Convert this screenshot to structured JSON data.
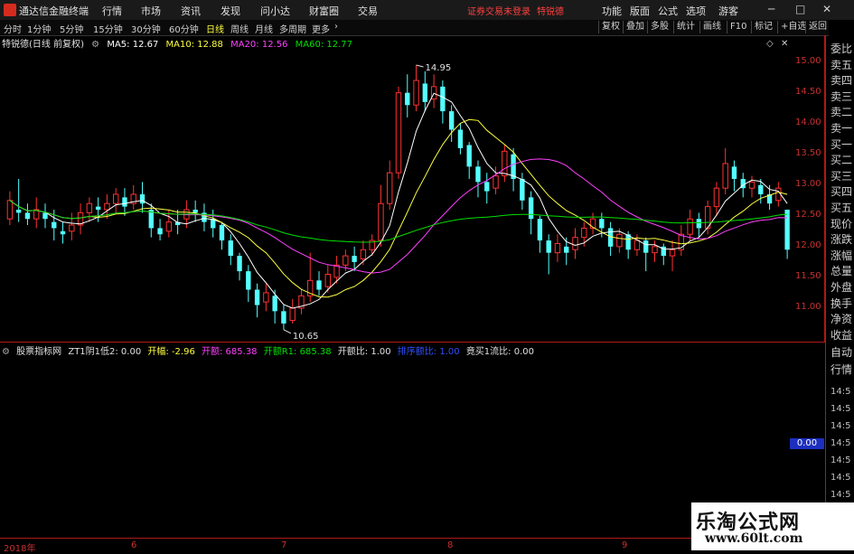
{
  "app": {
    "title": "通达信金融终端"
  },
  "menu": {
    "items": [
      "行情",
      "市场",
      "资讯",
      "发现",
      "问小达",
      "财富圈",
      "交易"
    ]
  },
  "header": {
    "login_notice": "证券交易未登录",
    "user": "特锐德"
  },
  "right_menu": [
    "功能",
    "版面",
    "公式",
    "选项",
    "游客"
  ],
  "periods": {
    "items": [
      "分时",
      "1分钟",
      "5分钟",
      "15分钟",
      "30分钟",
      "60分钟",
      "日线",
      "周线",
      "月线",
      "多周期",
      "更多"
    ],
    "active": "日线"
  },
  "toolbar": [
    "复权",
    "叠加",
    "多股",
    "统计",
    "画线",
    "F10",
    "标记",
    "+自选",
    "返回"
  ],
  "chart_header": {
    "stock": "特锐德(日线 前复权)",
    "ma5": "MA5: 12.67",
    "ma10": "MA10: 12.88",
    "ma20": "MA20: 12.56",
    "ma60": "MA60: 12.77"
  },
  "colors": {
    "up": "#ff3232",
    "down": "#54ffff",
    "ma5": "#ffffff",
    "ma10": "#ffff40",
    "ma20": "#ff40ff",
    "ma60": "#00e000",
    "axis": "#b01818"
  },
  "right_panel": {
    "labels": [
      "委比",
      "卖五",
      "卖四",
      "卖三",
      "卖二",
      "卖一",
      "买一",
      "买二",
      "买三",
      "买四",
      "买五",
      "现价",
      "涨跌",
      "涨幅",
      "总量",
      "外盘",
      "换手",
      "净资",
      "收益",
      "自动",
      "行情"
    ],
    "times": [
      "14:5",
      "14:5",
      "14:5",
      "14:5",
      "14:5",
      "14:5",
      "14:5",
      "14:5",
      "14:5"
    ]
  },
  "indicator": {
    "name": "股票指标网",
    "zt": "ZT1阴1低2: 0.00",
    "kaifu": "开幅: -2.96",
    "kaie": "开额: 685.38",
    "kaie_r1": "开额R1: 685.38",
    "kaie_bi": "开额比: 1.00",
    "paiming": "排序额比: 1.00",
    "jingmai": "竟买1流比: 0.00",
    "current_value": "0.00"
  },
  "dates": {
    "year": "2018年",
    "months": [
      "6",
      "7",
      "8",
      "9"
    ]
  },
  "watermark": {
    "line1": "乐淘公式网",
    "line2": "www.60lt.com"
  },
  "chart_data": {
    "type": "candlestick",
    "y_ticks": [
      15.0,
      14.5,
      14.0,
      13.5,
      13.0,
      12.5,
      12.0,
      11.5,
      11.0
    ],
    "ylim": [
      10.5,
      15.2
    ],
    "annotations": [
      {
        "label": "14.95",
        "value": 14.95
      },
      {
        "label": "10.65",
        "value": 10.65
      }
    ],
    "candles": [
      [
        12.45,
        12.75,
        12.35,
        12.9
      ],
      [
        12.6,
        12.55,
        12.4,
        13.1
      ],
      [
        12.55,
        12.45,
        12.35,
        12.7
      ],
      [
        12.45,
        12.6,
        12.3,
        12.8
      ],
      [
        12.55,
        12.45,
        12.3,
        12.7
      ],
      [
        12.4,
        12.3,
        12.1,
        12.6
      ],
      [
        12.25,
        12.2,
        12.05,
        12.4
      ],
      [
        12.25,
        12.35,
        12.1,
        12.55
      ],
      [
        12.35,
        12.55,
        12.2,
        12.7
      ],
      [
        12.55,
        12.7,
        12.4,
        12.8
      ],
      [
        12.65,
        12.6,
        12.4,
        12.8
      ],
      [
        12.6,
        12.7,
        12.45,
        12.85
      ],
      [
        12.7,
        12.85,
        12.55,
        12.95
      ],
      [
        12.8,
        12.65,
        12.5,
        12.95
      ],
      [
        12.7,
        12.85,
        12.6,
        13.0
      ],
      [
        12.85,
        12.7,
        12.55,
        13.05
      ],
      [
        12.6,
        12.3,
        12.15,
        12.7
      ],
      [
        12.3,
        12.2,
        12.1,
        12.45
      ],
      [
        12.25,
        12.4,
        12.15,
        12.6
      ],
      [
        12.4,
        12.35,
        12.2,
        12.6
      ],
      [
        12.45,
        12.6,
        12.3,
        12.75
      ],
      [
        12.6,
        12.55,
        12.4,
        12.75
      ],
      [
        12.55,
        12.4,
        12.25,
        12.7
      ],
      [
        12.45,
        12.3,
        12.15,
        12.6
      ],
      [
        12.35,
        12.1,
        11.95,
        12.4
      ],
      [
        12.1,
        11.85,
        11.7,
        12.2
      ],
      [
        11.85,
        11.6,
        11.45,
        11.9
      ],
      [
        11.6,
        11.3,
        11.1,
        11.7
      ],
      [
        11.3,
        11.05,
        10.85,
        11.4
      ],
      [
        11.1,
        11.25,
        10.95,
        11.4
      ],
      [
        11.2,
        10.95,
        10.75,
        11.3
      ],
      [
        10.95,
        10.75,
        10.65,
        11.05
      ],
      [
        10.8,
        11.0,
        10.75,
        11.15
      ],
      [
        11.0,
        11.2,
        10.9,
        11.3
      ],
      [
        11.2,
        11.45,
        11.1,
        11.9
      ],
      [
        11.45,
        11.3,
        11.2,
        11.6
      ],
      [
        11.35,
        11.55,
        11.25,
        11.7
      ],
      [
        11.5,
        11.7,
        11.4,
        11.85
      ],
      [
        11.7,
        11.85,
        11.6,
        11.95
      ],
      [
        11.85,
        11.75,
        11.6,
        12.0
      ],
      [
        11.8,
        11.95,
        11.7,
        12.1
      ],
      [
        11.95,
        12.1,
        11.85,
        12.2
      ],
      [
        12.1,
        12.7,
        12.0,
        13.0
      ],
      [
        12.7,
        13.2,
        12.6,
        13.4
      ],
      [
        13.2,
        14.5,
        13.1,
        14.6
      ],
      [
        14.5,
        14.3,
        14.1,
        14.8
      ],
      [
        14.3,
        14.7,
        14.2,
        14.95
      ],
      [
        14.65,
        14.35,
        14.2,
        14.85
      ],
      [
        14.4,
        14.6,
        14.25,
        14.8
      ],
      [
        14.6,
        14.2,
        14.0,
        14.7
      ],
      [
        14.2,
        13.9,
        13.7,
        14.3
      ],
      [
        13.9,
        13.6,
        13.5,
        14.0
      ],
      [
        13.65,
        13.3,
        13.1,
        13.7
      ],
      [
        13.3,
        13.05,
        12.8,
        13.4
      ],
      [
        13.05,
        12.9,
        12.7,
        13.2
      ],
      [
        12.95,
        13.15,
        12.85,
        13.3
      ],
      [
        13.15,
        13.55,
        13.05,
        13.65
      ],
      [
        13.5,
        13.1,
        12.9,
        13.6
      ],
      [
        13.1,
        12.75,
        12.6,
        13.2
      ],
      [
        12.8,
        12.45,
        12.2,
        12.9
      ],
      [
        12.45,
        12.1,
        11.9,
        12.5
      ],
      [
        12.1,
        11.9,
        11.55,
        12.2
      ],
      [
        11.9,
        12.05,
        11.75,
        12.2
      ],
      [
        12.0,
        11.9,
        11.7,
        12.15
      ],
      [
        11.95,
        12.15,
        11.8,
        12.3
      ],
      [
        12.15,
        12.3,
        12.0,
        12.4
      ],
      [
        12.3,
        12.45,
        12.2,
        12.55
      ],
      [
        12.45,
        12.3,
        12.15,
        12.55
      ],
      [
        12.3,
        12.0,
        11.85,
        12.4
      ],
      [
        12.0,
        12.2,
        11.9,
        12.3
      ],
      [
        12.2,
        11.95,
        11.8,
        12.25
      ],
      [
        11.95,
        12.1,
        11.85,
        12.2
      ],
      [
        12.1,
        11.9,
        11.6,
        12.15
      ],
      [
        11.9,
        12.0,
        11.75,
        12.1
      ],
      [
        12.0,
        11.85,
        11.7,
        12.05
      ],
      [
        11.85,
        11.95,
        11.6,
        12.1
      ],
      [
        11.95,
        12.2,
        11.85,
        12.35
      ],
      [
        12.2,
        12.45,
        12.1,
        12.6
      ],
      [
        12.45,
        12.3,
        12.15,
        12.55
      ],
      [
        12.3,
        12.65,
        12.2,
        12.75
      ],
      [
        12.65,
        12.95,
        12.5,
        13.05
      ],
      [
        12.95,
        13.35,
        12.85,
        13.6
      ],
      [
        13.3,
        13.1,
        12.9,
        13.4
      ],
      [
        13.1,
        12.95,
        12.8,
        13.2
      ],
      [
        12.95,
        13.05,
        12.8,
        13.15
      ],
      [
        13.0,
        12.85,
        12.7,
        13.1
      ],
      [
        12.85,
        12.7,
        12.6,
        13.0
      ],
      [
        12.75,
        12.95,
        12.65,
        13.05
      ],
      [
        12.6,
        11.95,
        11.8,
        12.55
      ]
    ],
    "lower_series_values": []
  }
}
